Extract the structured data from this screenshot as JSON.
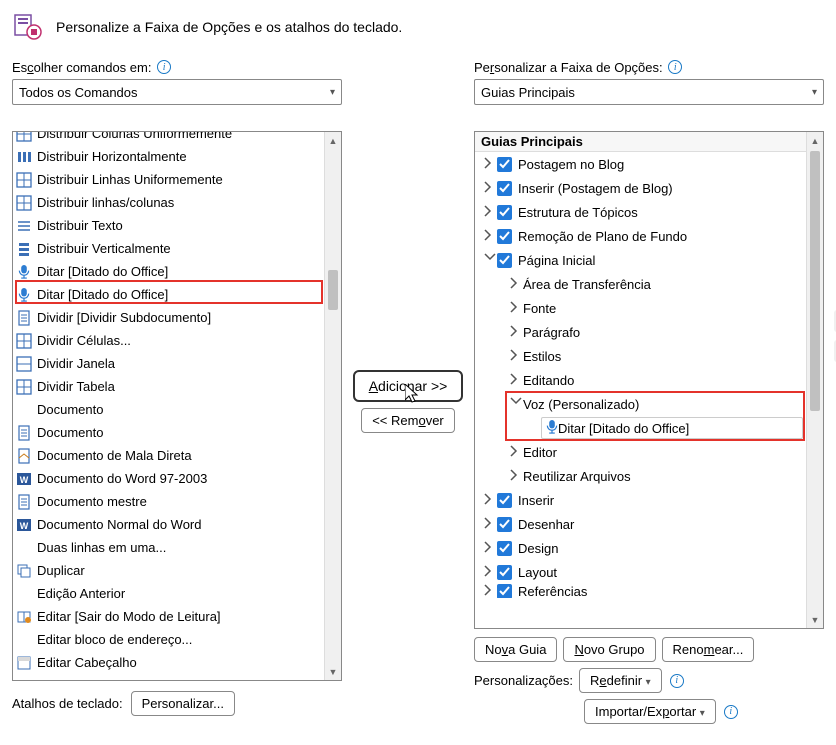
{
  "header": {
    "title": "Personalize a Faixa de Opções e os atalhos do teclado."
  },
  "left": {
    "label_pre": "Es",
    "label_u": "c",
    "label_post": "olher comandos em:",
    "dropdown_value": "Todos os Comandos",
    "items": [
      {
        "label": "Distribuir Colunas Uniformemente",
        "icon": "dist-cols"
      },
      {
        "label": "Distribuir Horizontalmente",
        "icon": "dist-h"
      },
      {
        "label": "Distribuir Linhas Uniformemente",
        "icon": "dist-rows"
      },
      {
        "label": "Distribuir linhas/colunas",
        "icon": "dist-rc"
      },
      {
        "label": "Distribuir Texto",
        "icon": "dist-text"
      },
      {
        "label": "Distribuir Verticalmente",
        "icon": "dist-v"
      },
      {
        "label": "Ditar [Ditado do Office]",
        "icon": "mic"
      },
      {
        "label": "Ditar [Ditado do Office]",
        "icon": "mic",
        "hl": true,
        "scroll": true
      },
      {
        "label": "Dividir [Dividir Subdocumento]",
        "icon": "split-sub"
      },
      {
        "label": "Dividir Células...",
        "icon": "split-cells"
      },
      {
        "label": "Dividir Janela",
        "icon": "split-win"
      },
      {
        "label": "Dividir Tabela",
        "icon": "split-tbl"
      },
      {
        "label": "Documento",
        "icon": "none",
        "chev": true,
        "empty": true
      },
      {
        "label": "Documento",
        "icon": "doc"
      },
      {
        "label": "Documento de Mala Direta",
        "icon": "doc-mail"
      },
      {
        "label": "Documento do Word 97-2003",
        "icon": "doc-w"
      },
      {
        "label": "Documento mestre",
        "icon": "doc-master"
      },
      {
        "label": "Documento Normal do Word",
        "icon": "doc-w"
      },
      {
        "label": "Duas linhas em uma...",
        "icon": "none",
        "empty": true
      },
      {
        "label": "Duplicar",
        "icon": "dup"
      },
      {
        "label": "Edição Anterior",
        "icon": "none",
        "empty": true
      },
      {
        "label": "Editar [Sair do Modo de Leitura]",
        "icon": "edit-read"
      },
      {
        "label": "Editar bloco de endereço...",
        "icon": "none",
        "empty": true
      },
      {
        "label": "Editar Cabeçalho",
        "icon": "edit-head"
      }
    ]
  },
  "middle": {
    "add_pre": "",
    "add_u": "A",
    "add_post": "dicionar >>",
    "remove_pre": "<< Rem",
    "remove_u": "o",
    "remove_post": "ver"
  },
  "right": {
    "label_pre": "Pe",
    "label_u": "r",
    "label_post": "sonalizar a Faixa de Opções:",
    "dropdown_value": "Guias Principais",
    "tree_head": "Guias Principais",
    "top_items": [
      "Postagem no Blog",
      "Inserir (Postagem de Blog)",
      "Estrutura de Tópicos",
      "Remoção de Plano de Fundo"
    ],
    "home_label": "Página Inicial",
    "home_children": [
      "Área de Transferência",
      "Fonte",
      "Parágrafo",
      "Estilos",
      "Editando"
    ],
    "voice_label": "Voz (Personalizado)",
    "voice_leaf": "Ditar [Ditado do Office]",
    "home_children_after": [
      "Editor",
      "Reutilizar Arquivos"
    ],
    "bottom_items": [
      "Inserir",
      "Desenhar",
      "Design",
      "Layout",
      "Referências"
    ],
    "btn_nova_pre": "No",
    "btn_nova_u": "v",
    "btn_nova_post": "a Guia",
    "btn_grupo_pre": "",
    "btn_grupo_u": "N",
    "btn_grupo_post": "ovo Grupo",
    "btn_ren_pre": "Reno",
    "btn_ren_u": "m",
    "btn_ren_post": "ear...",
    "pers_label": "Personalizações:",
    "btn_redef_pre": "R",
    "btn_redef_u": "e",
    "btn_redef_post": "definir",
    "btn_imp_pre": "Importar/Ex",
    "btn_imp_u": "p",
    "btn_imp_post": "ortar"
  },
  "bottom_left": {
    "label": "Atalhos de teclado:",
    "btn": "Personalizar..."
  }
}
